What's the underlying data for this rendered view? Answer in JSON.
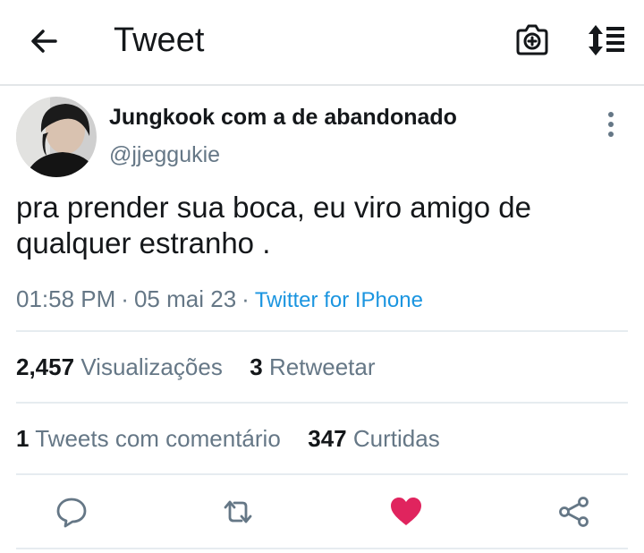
{
  "header": {
    "title": "Tweet",
    "icons": [
      "back-arrow-icon",
      "camera-plus-icon",
      "sort-list-icon"
    ]
  },
  "tweet": {
    "author_name": "Jungkook com a de abandonado",
    "author_handle": "@jjeggukie",
    "text": "pra prender sua boca, eu viro amigo de qualquer estranho .",
    "time": "01:58 PM",
    "separator": "·",
    "date": "05 mai 23",
    "source": "Twitter for IPhone"
  },
  "stats": {
    "views_count": "2,457",
    "views_label": "Visualizações",
    "retweets_count": "3",
    "retweets_label": "Retweetar",
    "quotes_count": "1",
    "quotes_label": "Tweets com comentário",
    "likes_count": "347",
    "likes_label": "Curtidas"
  },
  "actions": {
    "icons": [
      "reply-icon",
      "retweet-icon",
      "heart-icon",
      "share-icon"
    ],
    "liked": true
  },
  "colors": {
    "accent": "#1b95e0",
    "muted": "#657786",
    "like": "#e0245e",
    "text": "#14171a",
    "divider": "#e6ecf0"
  }
}
